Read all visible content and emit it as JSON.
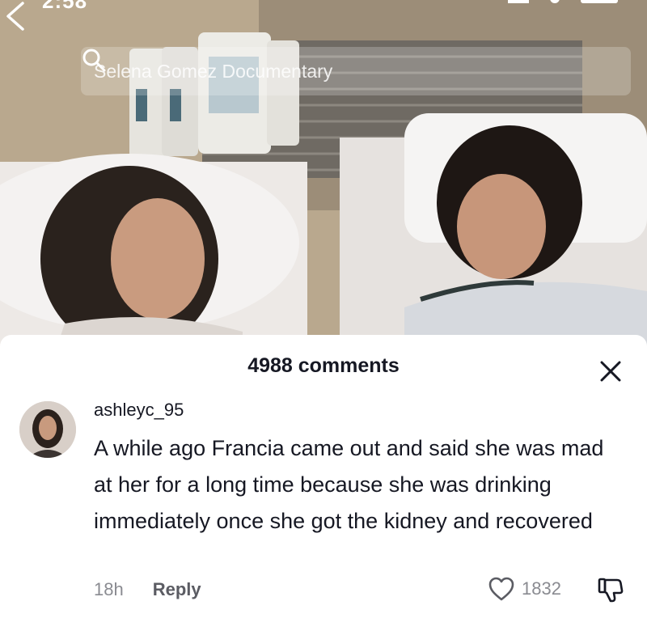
{
  "status_bar": {
    "time": "2:58"
  },
  "search": {
    "query": "Selena Gomez Documentary"
  },
  "comments": {
    "header": "4988 comments",
    "items": [
      {
        "username": "ashleyc_95",
        "text": "A while ago Francia came out and said she was mad at her for a long time because she was drinking immediately once she got the kidney and recovered",
        "time_ago": "18h",
        "reply_label": "Reply",
        "like_count": "1832"
      }
    ]
  },
  "icons": {
    "back": "chevron-left-icon",
    "search": "search-icon",
    "close": "close-icon",
    "like": "heart-outline-icon",
    "dislike": "thumbs-down-icon"
  },
  "colors": {
    "text_primary": "#161823",
    "text_secondary": "#8a8b91",
    "sheet_bg": "#ffffff"
  }
}
